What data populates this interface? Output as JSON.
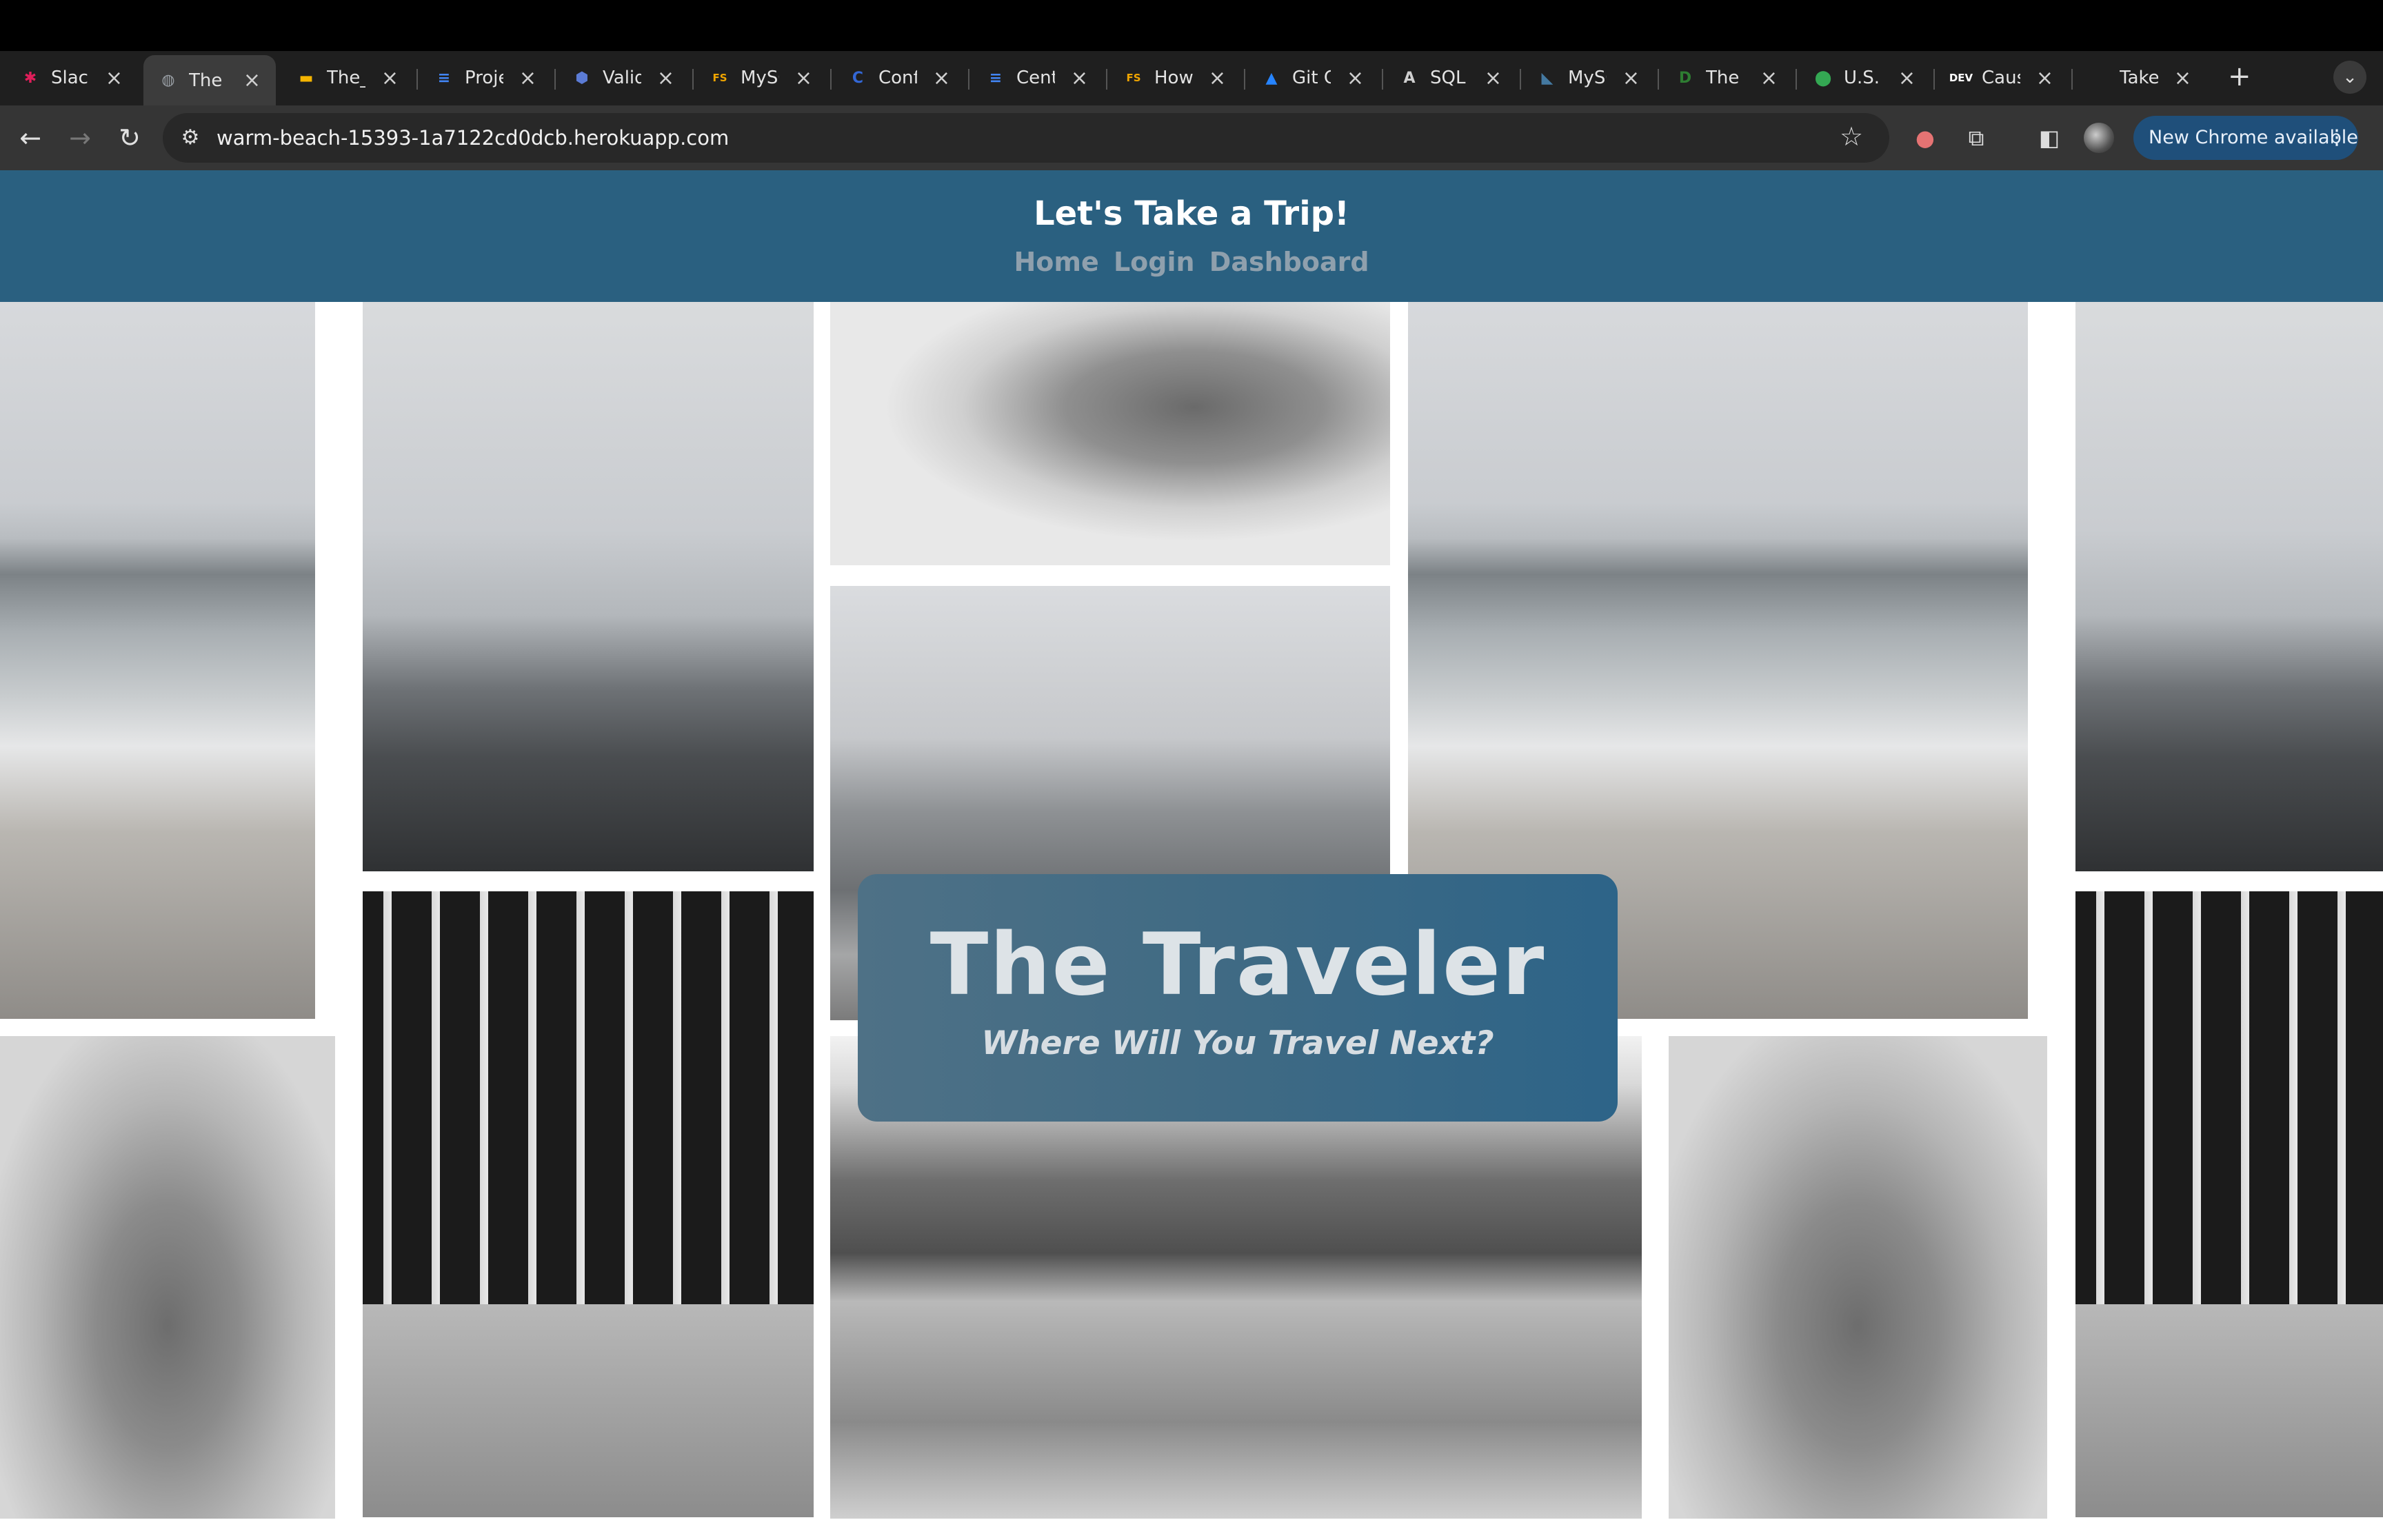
{
  "browser": {
    "tabs": [
      {
        "label": "Slack",
        "favicon": "slack-icon",
        "color": "#e01e5a"
      },
      {
        "label": "The T",
        "favicon": "globe-icon",
        "color": "#9aa0a6"
      },
      {
        "label": "The_",
        "favicon": "slides-icon",
        "color": "#f4b400"
      },
      {
        "label": "Proje",
        "favicon": "docs-icon",
        "color": "#4285f4"
      },
      {
        "label": "Valid",
        "favicon": "cube-icon",
        "color": "#5b7bd5"
      },
      {
        "label": "MySC",
        "favicon": "fs-icon",
        "color": "#f0a500"
      },
      {
        "label": "Confi",
        "favicon": "c-icon",
        "color": "#3367d6"
      },
      {
        "label": "Centr",
        "favicon": "docs-icon",
        "color": "#4285f4"
      },
      {
        "label": "How",
        "favicon": "fs-icon",
        "color": "#f0a500"
      },
      {
        "label": "Git C",
        "favicon": "atlassian-icon",
        "color": "#2684ff"
      },
      {
        "label": "SQL",
        "favicon": "a-icon",
        "color": "#cfcfcf"
      },
      {
        "label": "MySC",
        "favicon": "mysql-icon",
        "color": "#4479a1"
      },
      {
        "label": "The C",
        "favicon": "d-icon",
        "color": "#2e7d32"
      },
      {
        "label": "U.S.",
        "favicon": "maps-icon",
        "color": "#34a853"
      },
      {
        "label": "Caus",
        "favicon": "dev-icon",
        "color": "#ffffff"
      },
      {
        "label": "Take",
        "favicon": "apple-icon",
        "color": "#bbbbbb"
      }
    ],
    "active_tab_index": 1,
    "fav_glyphs": {
      "slack-icon": "✱",
      "globe-icon": "◍",
      "slides-icon": "▬",
      "docs-icon": "≡",
      "cube-icon": "⬢",
      "fs-icon": "FS",
      "c-icon": "C",
      "atlassian-icon": "▲",
      "a-icon": "A",
      "mysql-icon": "◣",
      "d-icon": "D",
      "maps-icon": "⬤",
      "dev-icon": "DEV",
      "apple-icon": ""
    },
    "url": "warm-beach-15393-1a7122cd0dcb.herokuapp.com",
    "update_button_label": "New Chrome available"
  },
  "site": {
    "header_title": "Let's Take a Trip!",
    "nav": [
      "Home",
      "Login",
      "Dashboard"
    ],
    "hero_title": "The Traveler",
    "hero_subtitle": "Where Will You Travel Next?"
  },
  "colors": {
    "header_bg": "#2a6080",
    "nav_text": "#8fa0ad",
    "hero_bg": "#3f6a84"
  }
}
